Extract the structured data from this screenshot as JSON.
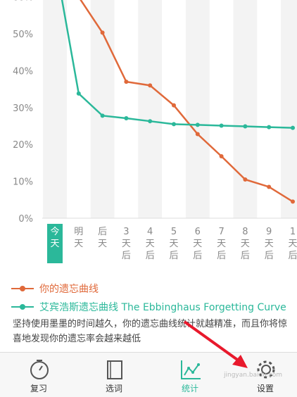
{
  "chart_data": {
    "type": "line",
    "categories": [
      [
        "今",
        "天"
      ],
      [
        "明",
        "天"
      ],
      [
        "后",
        "天"
      ],
      [
        "3",
        "天",
        "后"
      ],
      [
        "4",
        "天",
        "后"
      ],
      [
        "5",
        "天",
        "后"
      ],
      [
        "6",
        "天",
        "后"
      ],
      [
        "7",
        "天",
        "后"
      ],
      [
        "8",
        "天",
        "后"
      ],
      [
        "9",
        "天",
        "后"
      ],
      [
        "1",
        "天",
        "后"
      ]
    ],
    "yticks": [
      "0%",
      "10%",
      "20%",
      "30%",
      "40%",
      "50%",
      "60%"
    ],
    "ylim": [
      0,
      60
    ],
    "series": [
      {
        "name": "你的遗忘曲线",
        "color": "#e0693a",
        "values": [
          70,
          60,
          50.3,
          37,
          36,
          30.6,
          22.8,
          16.8,
          10.5,
          8.5,
          4.5
        ]
      },
      {
        "name": "艾宾浩斯遗忘曲线 The Ebbinghaus Forgetting Curve",
        "color": "#2bb89a",
        "values": [
          70,
          33.8,
          27.8,
          27.1,
          26.3,
          25.5,
          25.3,
          25.1,
          24.9,
          24.7,
          24.5
        ]
      }
    ],
    "highlight_index": 0,
    "grid": "vertical-stripes"
  },
  "legend": {
    "mine": "你的遗忘曲线",
    "ebbinghaus": "艾宾浩斯遗忘曲线 The Ebbinghaus Forgetting Curve"
  },
  "description": "坚持使用墨墨的时间越久，你的遗忘曲线统计就越精准，而且你将惊喜地发现你的遗忘率会越来越低",
  "tabs": [
    {
      "label": "复习",
      "icon": "clock-icon"
    },
    {
      "label": "选词",
      "icon": "book-icon"
    },
    {
      "label": "统计",
      "icon": "chart-icon",
      "active": true
    },
    {
      "label": "设置",
      "icon": "gear-icon"
    }
  ],
  "watermark": "jingyan.baidu.com",
  "colors": {
    "accent": "#2bb89a",
    "mine": "#e0693a",
    "arrow": "#e8192c"
  }
}
